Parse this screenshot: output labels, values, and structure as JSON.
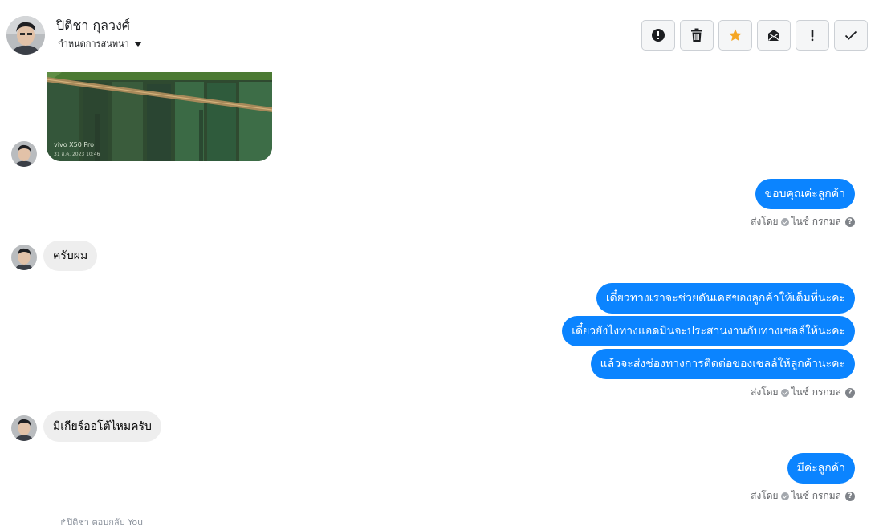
{
  "header": {
    "name": "ปิติชา กุลวงศ์",
    "conversation_label": "กำหนดการสนทนา",
    "toolbar": [
      {
        "name": "report-button",
        "icon": "alert-circle-icon",
        "color": "#1c1e21"
      },
      {
        "name": "delete-button",
        "icon": "trash-icon",
        "color": "#1c1e21"
      },
      {
        "name": "star-button",
        "icon": "star-icon",
        "color": "#f5a623"
      },
      {
        "name": "mark-unread-button",
        "icon": "envelope-icon",
        "color": "#1c1e21"
      },
      {
        "name": "important-button",
        "icon": "exclamation-icon",
        "color": "#1c1e21"
      },
      {
        "name": "done-button",
        "icon": "check-icon",
        "color": "#1c1e21"
      }
    ]
  },
  "photo": {
    "caption_model": "vivo X50 Pro",
    "caption_date": "31 ส.ค. 2023 10:46"
  },
  "messages": {
    "out_1": "ขอบคุณค่ะลูกค้า",
    "in_1": "ครับผม",
    "out_2": "เดี๋ยวทางเราจะช่วยดันเคสของลูกค้าให้เต็มที่นะคะ",
    "out_3": "เดี๋ยวยังไงทางแอดมินจะประสานงานกับทางเซลล์ให้นะคะ",
    "out_4": "แล้วจะส่งช่องทางการติดต่อของเซลล์ให้ลูกค้านะคะ",
    "in_2": "มีเกียร์ออโต้ไหมครับ",
    "out_5": "มีค่ะลูกค้า"
  },
  "meta": {
    "sent_by": "ส่งโดย",
    "sender": "ไนซ์ กรกมล",
    "help": "?"
  },
  "reply_note": "ปิติชา ตอบกลับ You",
  "colors": {
    "outgoing_bubble": "#0b84ff",
    "incoming_bubble": "#eeeeee"
  }
}
